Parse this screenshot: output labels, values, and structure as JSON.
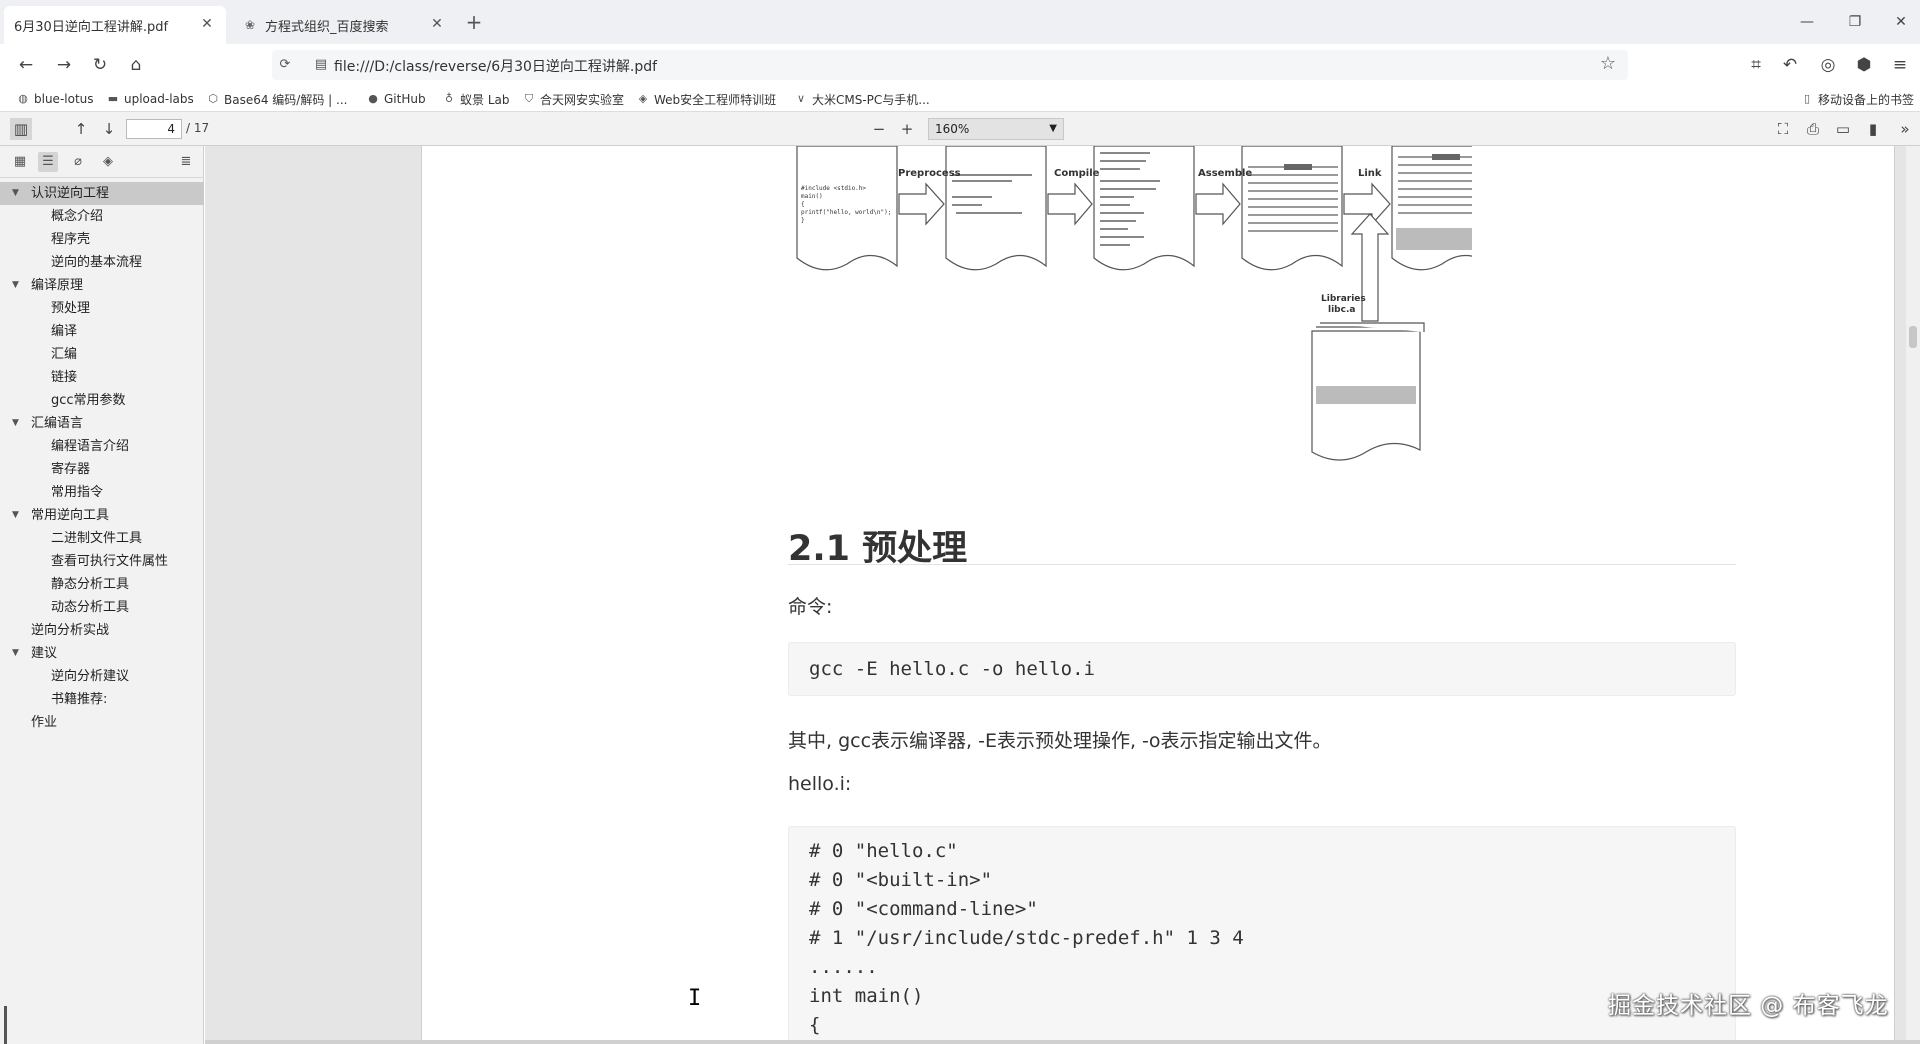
{
  "browser": {
    "tabs": [
      {
        "title": "6月30日逆向工程讲解.pdf",
        "active": true
      },
      {
        "title": "方程式组织_百度搜索",
        "active": false
      }
    ],
    "address": "file:///D:/class/reverse/6月30日逆向工程讲解.pdf",
    "bookmarks": [
      {
        "label": "blue-lotus",
        "icon": "globe-icon"
      },
      {
        "label": "upload-labs",
        "icon": "folder-icon"
      },
      {
        "label": "Base64 编码/解码 | ...",
        "icon": "cube-icon"
      },
      {
        "label": "GitHub",
        "icon": "github-icon"
      },
      {
        "label": "蚁景 Lab",
        "icon": "lab-icon"
      },
      {
        "label": "合天网安实验室",
        "icon": "shield-icon"
      },
      {
        "label": "Web安全工程师特训班",
        "icon": "diamond-icon"
      },
      {
        "label": "大米CMS-PC与手机...",
        "icon": "chevron-icon"
      }
    ],
    "mobile_bookmarks": "移动设备上的书签"
  },
  "pdf_toolbar": {
    "page_number": "4",
    "page_count": "/ 17",
    "zoom": "160%"
  },
  "outline": [
    {
      "label": "认识逆向工程",
      "level": 0,
      "expanded": true,
      "selected": true
    },
    {
      "label": "概念介绍",
      "level": 1
    },
    {
      "label": "程序壳",
      "level": 1
    },
    {
      "label": "逆向的基本流程",
      "level": 1
    },
    {
      "label": "编译原理",
      "level": 0,
      "expanded": true
    },
    {
      "label": "预处理",
      "level": 1
    },
    {
      "label": "编译",
      "level": 1
    },
    {
      "label": "汇编",
      "level": 1
    },
    {
      "label": "链接",
      "level": 1
    },
    {
      "label": "gcc常用参数",
      "level": 1
    },
    {
      "label": "汇编语言",
      "level": 0,
      "expanded": true
    },
    {
      "label": "编程语言介绍",
      "level": 1
    },
    {
      "label": "寄存器",
      "level": 1
    },
    {
      "label": "常用指令",
      "level": 1
    },
    {
      "label": "常用逆向工具",
      "level": 0,
      "expanded": true
    },
    {
      "label": "二进制文件工具",
      "level": 1
    },
    {
      "label": "查看可执行文件属性",
      "level": 1
    },
    {
      "label": "静态分析工具",
      "level": 1
    },
    {
      "label": "动态分析工具",
      "level": 1
    },
    {
      "label": "逆向分析实战",
      "level": 0
    },
    {
      "label": "建议",
      "level": 0,
      "expanded": true
    },
    {
      "label": "逆向分析建议",
      "level": 1
    },
    {
      "label": "书籍推荐:",
      "level": 1
    },
    {
      "label": "作业",
      "level": 0
    }
  ],
  "document": {
    "diagram": {
      "stages": [
        "Preprocess",
        "Compile",
        "Assemble",
        "Link"
      ],
      "libraries_label_1": "Libraries",
      "libraries_label_2": "libc.a",
      "source_lines": [
        "#include <stdio.h>",
        "main()",
        "{",
        "  printf(\"hello, world\\n\");",
        "}"
      ]
    },
    "section_title": "2.1 预处理",
    "command_label": "命令:",
    "command_code": "gcc -E hello.c -o hello.i",
    "explanation": "其中, gcc表示编译器, -E表示预处理操作, -o表示指定输出文件。",
    "output_label": "hello.i:",
    "output_code": "# 0 \"hello.c\"\n# 0 \"<built-in>\"\n# 0 \"<command-line>\"\n# 1 \"/usr/include/stdc-predef.h\" 1 3 4\n......\nint main()\n{"
  },
  "watermark": "掘金技术社区 @ 布客飞龙"
}
